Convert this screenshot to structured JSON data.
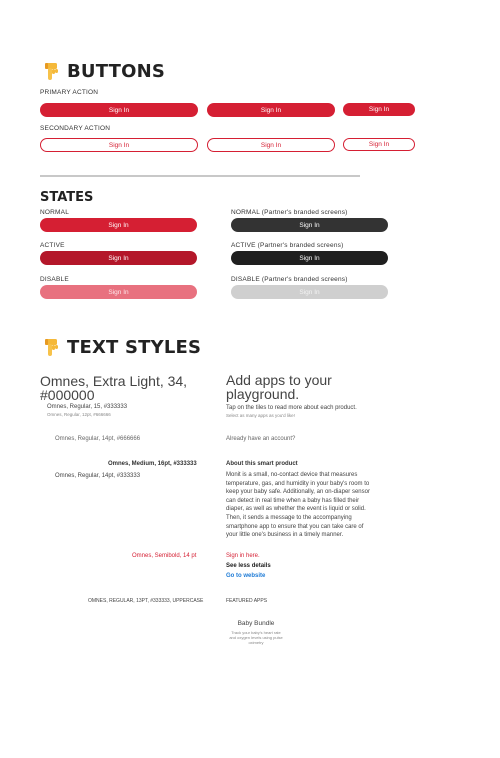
{
  "buttons_section": {
    "title": "BUTTONS",
    "primary_label": "PRIMARY ACTION",
    "secondary_label": "SECONDARY ACTION",
    "button_text": "Sign In"
  },
  "states_section": {
    "title": "STATES",
    "normal": "NORMAL",
    "normal_partner": "NORMAL (Partner's branded screens)",
    "active": "ACTIVE",
    "active_partner": "ACTIVE (Partner's branded screens)",
    "disable": "DISABLE",
    "disable_partner": "DISABLE (Partner's branded screens)",
    "button_text": "Sign In"
  },
  "text_styles": {
    "title": "TEXT STYLES",
    "spec_extra_light_line1": "Omnes, Extra Light, 34,",
    "spec_extra_light_line2": "#000000",
    "spec_regular_15": "Omnes, Regular, 15, #333333",
    "spec_regular_12": "Omnes, Regular, 12pt, #666666",
    "spec_regular_14_666": "Omnes, Regular, 14pt, #666666",
    "spec_medium_16": "Omnes, Medium, 16pt, #333333",
    "spec_regular_14_333": "Omnes, Regular, 14pt, #333333",
    "spec_semibold_14": "Omnes, Semibold, 14 pt",
    "spec_uppercase_13": "OMNES, REGULAR, 13PT, #333333, UPPERCASE",
    "sample_heading_line1": "Add apps to your",
    "sample_heading_line2": "playground.",
    "sample_tap": "Tap on the tiles to read more about each product.",
    "sample_select": "Select as many apps as you'd like!",
    "sample_account": "Already have an account?",
    "sample_about": "About this smart product",
    "sample_para": [
      "Monit is a small, no-contact device that measures",
      "temperature, gas, and humidity in your baby's room to",
      "keep your baby safe. Additionally, an on-diaper sensor",
      "can detect in real time when a baby has filled their",
      "diaper, as well as whether the event is liquid or solid.",
      "Then, it sends a message to the accompanying",
      "smartphone app to ensure that you can take care of",
      "your little one's business in a timely manner."
    ],
    "sample_signin": "Sign in here.",
    "sample_see_less": "See less details",
    "sample_go_website": "Go to website",
    "sample_featured": "FEATURED APPS",
    "sample_bundle": "Baby Bundle",
    "sample_bundle_desc": [
      "Track your baby's heart rate",
      "and oxygen levels using pulse",
      "oximetry"
    ]
  },
  "colors": {
    "brand_red": "#d51f33",
    "active_red": "#b4172a",
    "disabled_red": "#e8717f",
    "dark": "#333333",
    "link_blue": "#1e7bd6"
  },
  "icons": {
    "section_icon": "pointing-down-hand-icon"
  }
}
